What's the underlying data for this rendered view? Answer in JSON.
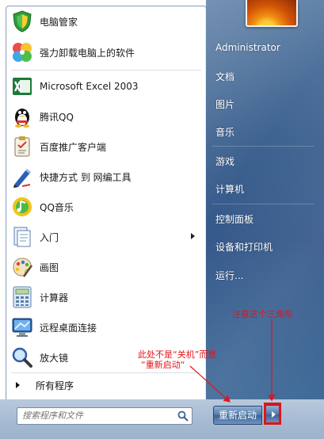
{
  "programs": [
    {
      "label": "电脑管家",
      "icon": "shield-icon"
    },
    {
      "label": "强力卸载电脑上的软件",
      "icon": "pinwheel-icon"
    },
    {
      "label": "Microsoft Excel 2003",
      "icon": "excel-icon"
    },
    {
      "label": "腾讯QQ",
      "icon": "penguin-icon"
    },
    {
      "label": "百度推广客户端",
      "icon": "clipboard-icon"
    },
    {
      "label": "快捷方式 到 网编工具",
      "icon": "pen-icon"
    },
    {
      "label": "QQ音乐",
      "icon": "music-icon"
    },
    {
      "label": "入门",
      "icon": "document-icon"
    },
    {
      "label": "画图",
      "icon": "palette-icon"
    },
    {
      "label": "计算器",
      "icon": "calculator-icon"
    },
    {
      "label": "远程桌面连接",
      "icon": "monitor-icon"
    },
    {
      "label": "放大镜",
      "icon": "magnifier-icon"
    }
  ],
  "all_programs_label": "所有程序",
  "search": {
    "placeholder": "搜索程序和文件"
  },
  "right_menu": {
    "user": "Administrator",
    "documents": "文档",
    "pictures": "图片",
    "music": "音乐",
    "games": "游戏",
    "computer": "计算机",
    "control_panel": "控制面板",
    "devices_printers": "设备和打印机",
    "run": "运行..."
  },
  "shutdown_label": "重新启动",
  "annotations": {
    "note1": "注意这个三角形",
    "note2_line1": "此处不是“关机”而是",
    "note2_line2": "“重新启动“"
  },
  "colors": {
    "accent_red": "#e0141a",
    "panel_blue": "#3e6390"
  }
}
